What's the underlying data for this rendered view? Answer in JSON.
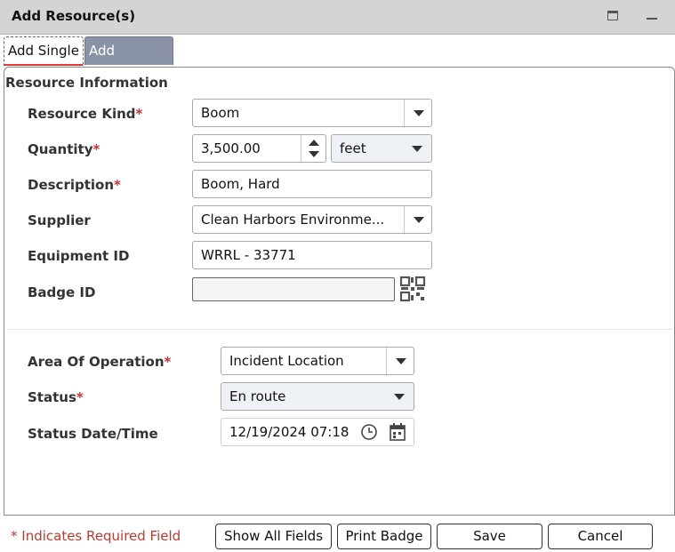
{
  "window": {
    "title": "Add Resource(s)"
  },
  "tabs": {
    "single": "Add Single",
    "multiple": "Add Multiple"
  },
  "section": {
    "title": "Resource Information"
  },
  "required_marker": "*",
  "fields": {
    "resource_kind": {
      "label": "Resource Kind",
      "value": "Boom"
    },
    "quantity": {
      "label": "Quantity",
      "value": "3,500.00",
      "unit": "feet"
    },
    "description": {
      "label": "Description",
      "value": "Boom, Hard"
    },
    "supplier": {
      "label": "Supplier",
      "value": "Clean Harbors Environme..."
    },
    "equipment_id": {
      "label": "Equipment ID",
      "value": "WRRL - 33771"
    },
    "badge_id": {
      "label": "Badge ID",
      "value": ""
    },
    "area_of_operation": {
      "label": "Area Of Operation",
      "value": "Incident Location"
    },
    "status": {
      "label": "Status",
      "value": "En route"
    },
    "status_datetime": {
      "label": "Status Date/Time",
      "value": "12/19/2024 07:18"
    }
  },
  "icons": {
    "maximize": "maximize-icon",
    "minimize": "minimize-icon",
    "qr": "qr-code-icon",
    "clock": "clock-icon",
    "calendar": "calendar-icon"
  },
  "footer": {
    "required_note": "* Indicates Required Field",
    "show_all_fields": "Show All Fields",
    "print_badge": "Print Badge",
    "save": "Save",
    "cancel": "Cancel"
  },
  "colors": {
    "required": "#d32f2f",
    "tab_inactive": "#8a93a6",
    "titlebar": "#d4d4d4"
  }
}
